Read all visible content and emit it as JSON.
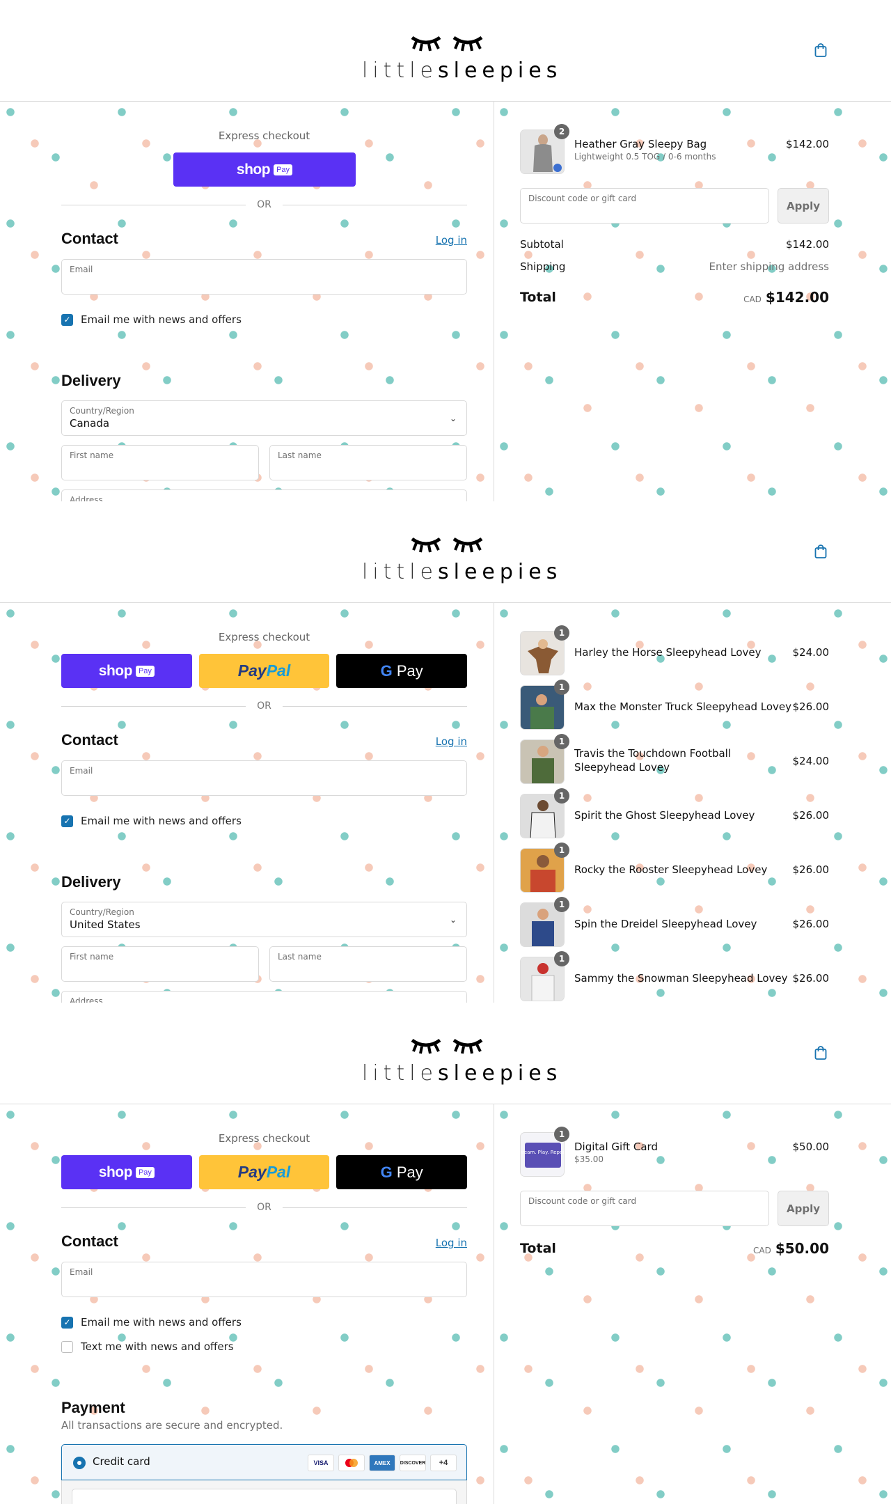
{
  "brand": {
    "light": "little",
    "bold": "sleepies"
  },
  "common": {
    "express_title": "Express checkout",
    "or": "OR",
    "contact_heading": "Contact",
    "login": "Log in",
    "email_label": "Email",
    "news_label": "Email me with news and offers",
    "delivery_heading": "Delivery",
    "country_label": "Country/Region",
    "first_name": "First name",
    "last_name": "Last name",
    "address_label": "Address",
    "discount_placeholder": "Discount code or gift card",
    "apply": "Apply",
    "shop_text": "shop",
    "shop_badge": "Pay",
    "paypal_a": "Pay",
    "paypal_b": "Pal",
    "gpay_g": "G",
    "gpay_text": " Pay"
  },
  "panel1": {
    "country_value": "Canada",
    "item": {
      "name": "Heather Gray Sleepy Bag",
      "variant": "Lightweight 0.5 TOG / 0-6 months",
      "price": "$142.00",
      "qty": "2"
    },
    "subtotal_label": "Subtotal",
    "subtotal_value": "$142.00",
    "shipping_label": "Shipping",
    "shipping_value": "Enter shipping address",
    "total_label": "Total",
    "currency": "CAD",
    "total_value": "$142.00"
  },
  "panel2": {
    "country_value": "United States",
    "items": [
      {
        "name": "Harley the Horse Sleepyhead Lovey",
        "price": "$24.00",
        "qty": "1"
      },
      {
        "name": "Max the Monster Truck Sleepyhead Lovey",
        "price": "$26.00",
        "qty": "1"
      },
      {
        "name": "Travis the Touchdown Football Sleepyhead Lovey",
        "price": "$24.00",
        "qty": "1"
      },
      {
        "name": "Spirit the Ghost Sleepyhead Lovey",
        "price": "$26.00",
        "qty": "1"
      },
      {
        "name": "Rocky the Rooster Sleepyhead Lovey",
        "price": "$26.00",
        "qty": "1"
      },
      {
        "name": "Spin the Dreidel Sleepyhead Lovey",
        "price": "$26.00",
        "qty": "1"
      },
      {
        "name": "Sammy the Snowman Sleepyhead Lovey",
        "price": "$26.00",
        "qty": "1"
      }
    ]
  },
  "panel3": {
    "text_label": "Text me with news and offers",
    "payment_heading": "Payment",
    "payment_sub": "All transactions are secure and encrypted.",
    "credit_card": "Credit card",
    "card_brands": [
      "VISA",
      "MC",
      "AMEX",
      "DISCOVER",
      "+4"
    ],
    "item": {
      "name": "Digital Gift Card",
      "variant": "$35.00",
      "price": "$50.00",
      "qty": "1",
      "thumb_text": "Dream. Play. Repeat"
    },
    "total_label": "Total",
    "currency": "CAD",
    "total_value": "$50.00"
  },
  "colors": {
    "accent": "#1773b0",
    "shop_pay": "#5a31f4",
    "paypal": "#ffc439",
    "dot_teal": "#82cdc6",
    "dot_peach": "#f6cab9"
  }
}
